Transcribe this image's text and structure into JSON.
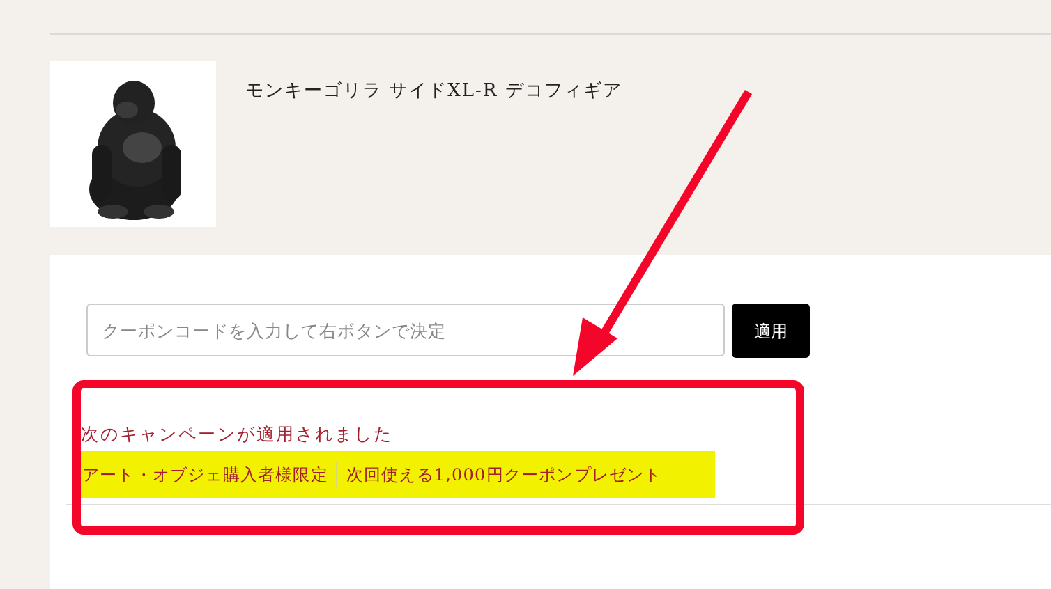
{
  "product": {
    "kind": "picture",
    "name": "モンキーゴリラ サイドXL-R デコフィギア"
  },
  "coupon": {
    "placeholder": "クーポンコードを入力して右ボタンで決定",
    "button": "適用"
  },
  "campaign": {
    "heading": "次のキャンペーンが適用されました",
    "items": [
      {
        "name": "アート・オブジェ購入者様限定",
        "benefit": "次回使える1,000円クーポンプレゼント"
      }
    ]
  }
}
